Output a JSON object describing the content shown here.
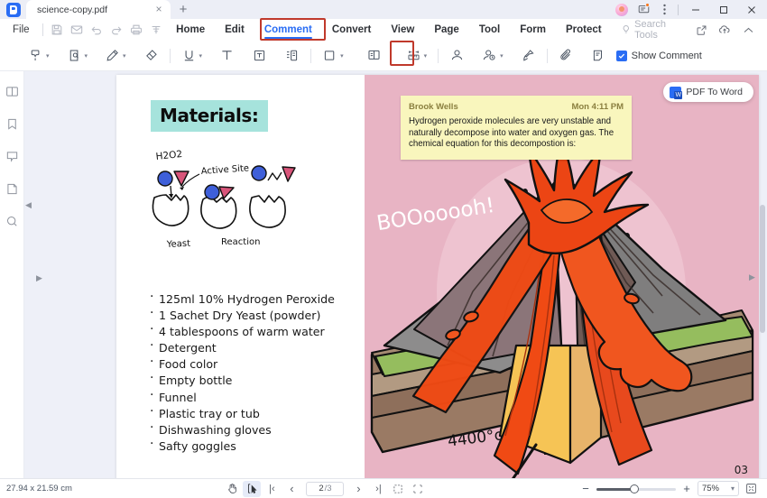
{
  "window": {
    "tab_title": "science-copy.pdf",
    "tab_close": "×",
    "new_tab": "+",
    "minimize": "─",
    "maximize": "☐",
    "close": "✕"
  },
  "menubar": {
    "file_label": "File",
    "quick_icons": [
      "save-icon",
      "mail-icon",
      "undo-icon",
      "redo-icon",
      "print-icon",
      "download-icon"
    ],
    "tabs": [
      {
        "label": "Home",
        "active": false
      },
      {
        "label": "Edit",
        "active": false
      },
      {
        "label": "Comment",
        "active": true
      },
      {
        "label": "Convert",
        "active": false
      },
      {
        "label": "View",
        "active": false
      },
      {
        "label": "Page",
        "active": false
      },
      {
        "label": "Tool",
        "active": false
      },
      {
        "label": "Form",
        "active": false
      },
      {
        "label": "Protect",
        "active": false
      }
    ],
    "search_label": "Search Tools",
    "right_icons": [
      "share-icon",
      "cloud-upload-icon",
      "collapse-ribbon-icon"
    ]
  },
  "toolbar": {
    "items": [
      {
        "name": "highlight-tool",
        "caret": true
      },
      {
        "name": "area-highlight-tool",
        "caret": true
      },
      {
        "name": "pencil-tool",
        "caret": true
      },
      {
        "name": "eraser-tool",
        "caret": false
      },
      {
        "name": "underline-tool",
        "caret": true
      },
      {
        "name": "text-tool",
        "caret": false
      },
      {
        "name": "text-box-tool",
        "caret": false
      },
      {
        "name": "text-callout-tool",
        "caret": false
      },
      {
        "name": "shape-tool",
        "caret": true
      },
      {
        "name": "sticky-note-tool",
        "caret": false,
        "highlighted": true
      },
      {
        "name": "measure-tool",
        "caret": true
      },
      {
        "name": "stamp-tool",
        "caret": false
      },
      {
        "name": "signature-tool",
        "caret": true
      },
      {
        "name": "pin-tool",
        "caret": false
      },
      {
        "name": "attachment-tool",
        "caret": false
      },
      {
        "name": "comment-list-tool",
        "caret": false
      }
    ],
    "show_comment_label": "Show Comment",
    "show_comment_checked": true
  },
  "left_rail": {
    "items": [
      {
        "name": "thumbnails-panel"
      },
      {
        "name": "bookmarks-panel"
      },
      {
        "name": "comments-panel"
      },
      {
        "name": "attachments-panel"
      },
      {
        "name": "search-panel"
      }
    ]
  },
  "document": {
    "left_page": {
      "heading": "Materials:",
      "diagram": {
        "label_h2o2": "H2O2",
        "label_active_site": "Active Site",
        "label_yeast": "Yeast",
        "label_reaction": "Reaction"
      },
      "materials_list": [
        "125ml 10% Hydrogen Peroxide",
        "1 Sachet Dry Yeast (powder)",
        "4 tablespoons of warm water",
        "Detergent",
        "Food color",
        "Empty bottle",
        "Funnel",
        "Plastic tray or tub",
        "Dishwashing gloves",
        "Safty goggles"
      ]
    },
    "right_page": {
      "boom_text": "BOOooooh!",
      "temperature": "4400°c",
      "page_number": "03",
      "background_color": "#e8b4c4"
    },
    "sticky_note": {
      "author": "Brook Wells",
      "timestamp": "Mon 4:11 PM",
      "body": "Hydrogen peroxide molecules are very unstable and naturally decompose into water and oxygen gas. The chemical equation for this decompostion is:",
      "background_color": "#f9f6bd"
    }
  },
  "pdf_to_word": {
    "label": "PDF To Word"
  },
  "statusbar": {
    "dimensions": "27.94 x 21.59 cm",
    "hand_tool": "hand-tool",
    "select_tool": "select-tool",
    "first_page": "|‹",
    "prev_page": "‹",
    "next_page": "›",
    "last_page": "›|",
    "current_page": "2",
    "total_pages": "/3",
    "zoom_out": "−",
    "zoom_in": "+",
    "zoom_level": "75%",
    "zoom_caret": "⌄"
  },
  "colors": {
    "accent": "#2a6df4",
    "highlight_box": "#c0392b",
    "sticky_yellow": "#f9f6bd",
    "page_pink": "#e8b4c4",
    "heading_teal": "#a6e3dc"
  }
}
